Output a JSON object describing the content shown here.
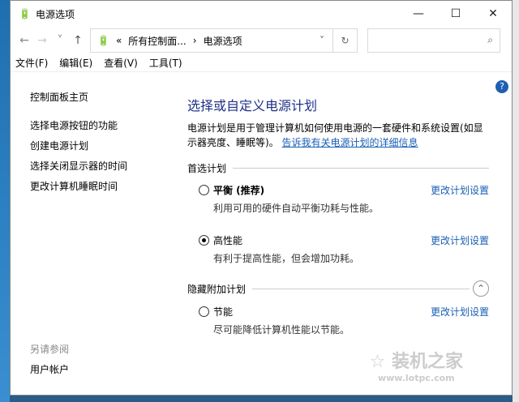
{
  "window": {
    "title": "电源选项",
    "minimize": "—",
    "maximize": "☐",
    "close": "✕"
  },
  "nav": {
    "back": "←",
    "forward": "→",
    "recent": "˅",
    "up": "↑",
    "breadcrumb": [
      "«",
      "所有控制面...",
      "›",
      "电源选项"
    ],
    "dropdown": "˅",
    "refresh": "↻",
    "search_icon": "⌕",
    "search_placeholder": ""
  },
  "menu": [
    "文件(F)",
    "编辑(E)",
    "查看(V)",
    "工具(T)"
  ],
  "sidebar": {
    "home": "控制面板主页",
    "items": [
      "选择电源按钮的功能",
      "创建电源计划",
      "选择关闭显示器的时间",
      "更改计算机睡眠时间"
    ],
    "see_also": "另请参阅",
    "user_accounts": "用户帐户"
  },
  "main": {
    "title": "选择或自定义电源计划",
    "desc": "电源计划是用于管理计算机如何使用电源的一套硬件和系统设置(如显示器亮度、睡眠等)。",
    "desc_link": "告诉我有关电源计划的详细信息",
    "preferred": "首选计划",
    "hidden": "隐藏附加计划",
    "plans": [
      {
        "name": "平衡 (推荐)",
        "desc": "利用可用的硬件自动平衡功耗与性能。",
        "change": "更改计划设置",
        "selected": false
      },
      {
        "name": "高性能",
        "desc": "有利于提高性能，但会增加功耗。",
        "change": "更改计划设置",
        "selected": true
      },
      {
        "name": "节能",
        "desc": "尽可能降低计算机性能以节能。",
        "change": "更改计划设置",
        "selected": false
      }
    ]
  },
  "help": "?",
  "watermark": {
    "name": "装机之家",
    "url": "www.lotpc.com"
  }
}
